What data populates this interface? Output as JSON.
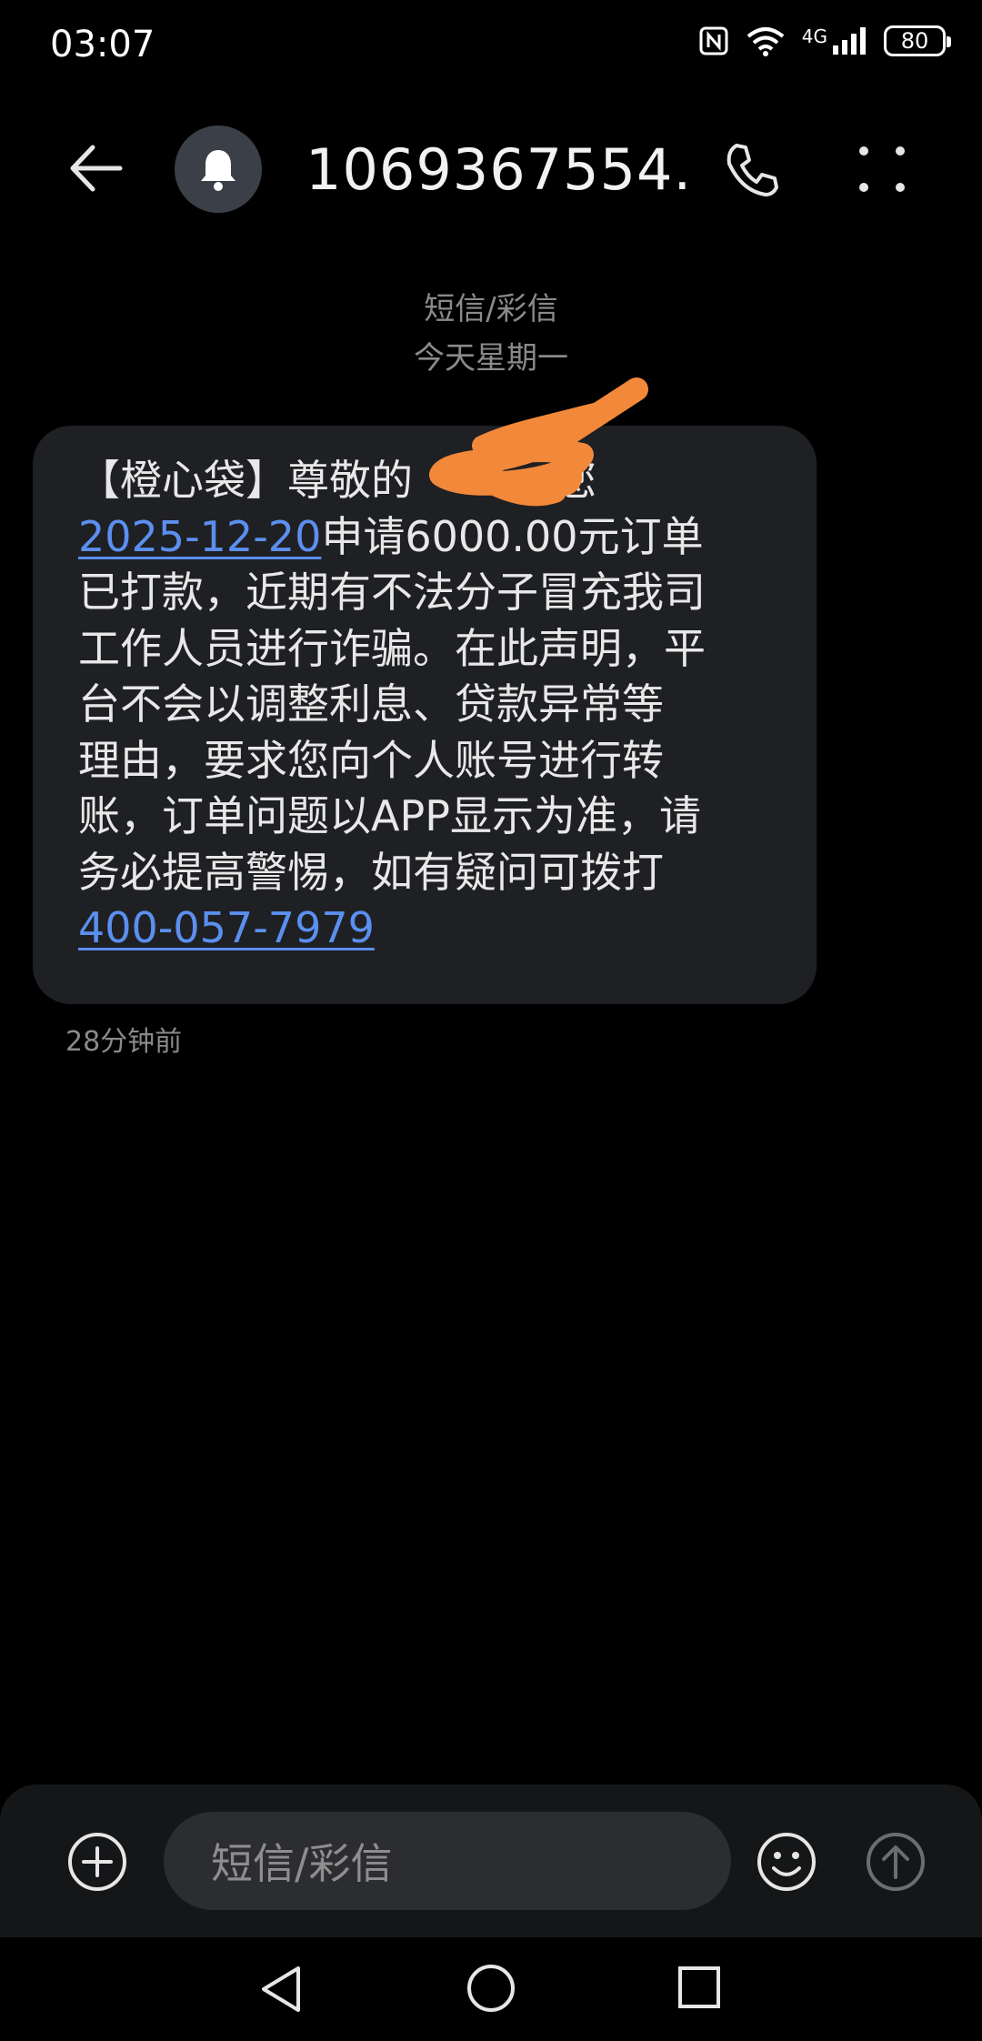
{
  "status_bar": {
    "time": "03:07",
    "network": "4G",
    "battery": "80",
    "icons": [
      "nfc-icon",
      "wifi-icon",
      "signal-icon",
      "battery-icon"
    ]
  },
  "header": {
    "contact": "1069367554...",
    "icons": [
      "back-arrow-icon",
      "bell-icon",
      "phone-icon",
      "more-vertical-icon"
    ]
  },
  "thread": {
    "type_label": "短信/彩信",
    "date_label": "今天星期一"
  },
  "message": {
    "lines": [
      "【橙心袋】尊敬的",
      "",
      "申请6000.00元订单",
      "已打款，近期有不法分子冒充我司",
      "工作人员进行诈骗。在此声明，平",
      "台不会以调整利息、贷款异常等",
      "理由，要求您向个人账号进行转",
      "账，订单问题以APP显示为准，请",
      "务必提高警惕，如有疑问可拨打"
    ],
    "line1_tail": "，您",
    "date_link": "2025-12-20",
    "phone_link": "400-057-7979",
    "time_ago": "28分钟前"
  },
  "composer": {
    "placeholder": "短信/彩信",
    "icons": [
      "plus-circle-icon",
      "emoji-icon",
      "send-up-arrow-icon"
    ]
  },
  "nav": {
    "icons": [
      "nav-back-icon",
      "nav-home-icon",
      "nav-recent-icon"
    ]
  },
  "colors": {
    "background": "#000000",
    "bubble": "#1f2023",
    "link": "#5b8ff0",
    "muted_text": "#8a8a8a",
    "scribble": "#f2883a"
  }
}
